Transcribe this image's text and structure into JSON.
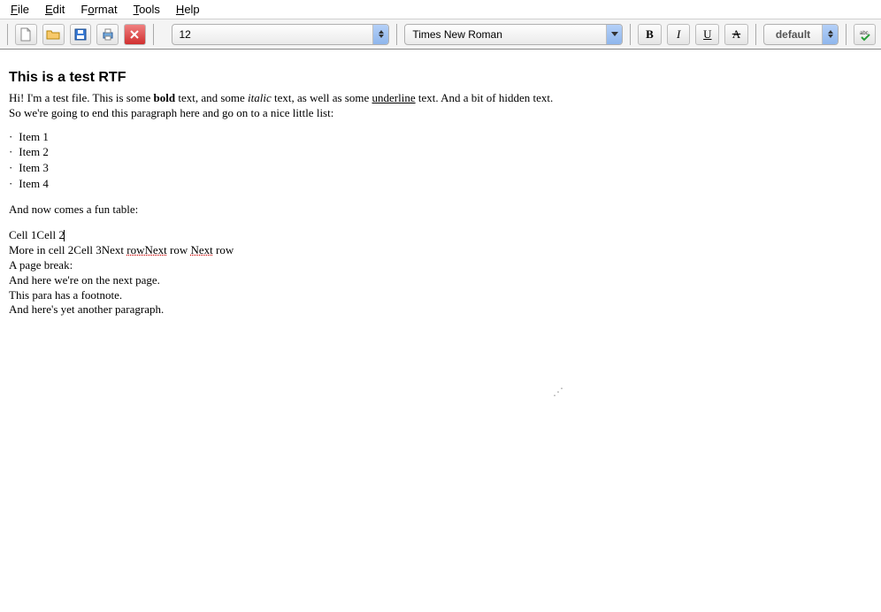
{
  "menu": {
    "file": "File",
    "edit": "Edit",
    "format": "Format",
    "tools": "Tools",
    "help": "Help"
  },
  "toolbar": {
    "font_size": "12",
    "font_name": "Times New Roman",
    "style_name": "default",
    "bold_label": "B",
    "italic_label": "I",
    "underline_label": "U",
    "strike_label": "A"
  },
  "doc": {
    "title": "This is a test RTF",
    "p_intro_1": "Hi! I'm a test file. This is some ",
    "p_intro_bold": "bold",
    "p_intro_2": " text, and some ",
    "p_intro_italic": "italic",
    "p_intro_3": " text, as well as some ",
    "p_intro_under": "underline",
    "p_intro_4": " text. And a bit of hidden text. So we're going to end this paragraph here and go on to a nice little list:",
    "list": [
      "Item 1",
      "Item 2",
      "Item 3",
      "Item 4"
    ],
    "p_table_intro": "And now comes a fun table:",
    "cell1": "Cell 1",
    "cell2": "Cell 2",
    "more_cell2": "More in cell 2",
    "cell3": "Cell 3",
    "next1": "Next",
    "row_err": "row",
    "next2": "Next",
    "row_txt": " row ",
    "next3": "Next",
    "row_end": " row",
    "page_break": "A page break:",
    "next_page": "And here we're on the next page.",
    "footnote_para": "This para has a footnote.",
    "another_para": "And here's yet another paragraph."
  }
}
